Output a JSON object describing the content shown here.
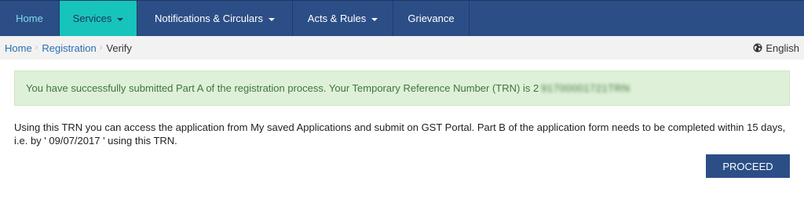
{
  "nav": {
    "items": [
      {
        "label": "Home"
      },
      {
        "label": "Services"
      },
      {
        "label": "Notifications & Circulars"
      },
      {
        "label": "Acts & Rules"
      },
      {
        "label": "Grievance"
      }
    ]
  },
  "breadcrumb": {
    "items": [
      "Home",
      "Registration",
      "Verify"
    ]
  },
  "language": {
    "label": "English",
    "icon": "globe-icon"
  },
  "alert": {
    "text": "You have successfully submitted Part A of the registration process. Your Temporary Reference Number (TRN) is 2",
    "trn_masked": "91700001721TRN"
  },
  "info": {
    "text": "Using this TRN you can access the application from My saved Applications and submit on GST Portal. Part B of the application form needs to be completed within 15 days, i.e. by ' 09/07/2017 ' using this TRN."
  },
  "actions": {
    "proceed_label": "PROCEED"
  },
  "colors": {
    "nav_bg": "#2c4e86",
    "nav_active": "#17c4bb",
    "success_bg": "#dff0d8",
    "success_text": "#3c763d",
    "link": "#2a6fb0"
  }
}
